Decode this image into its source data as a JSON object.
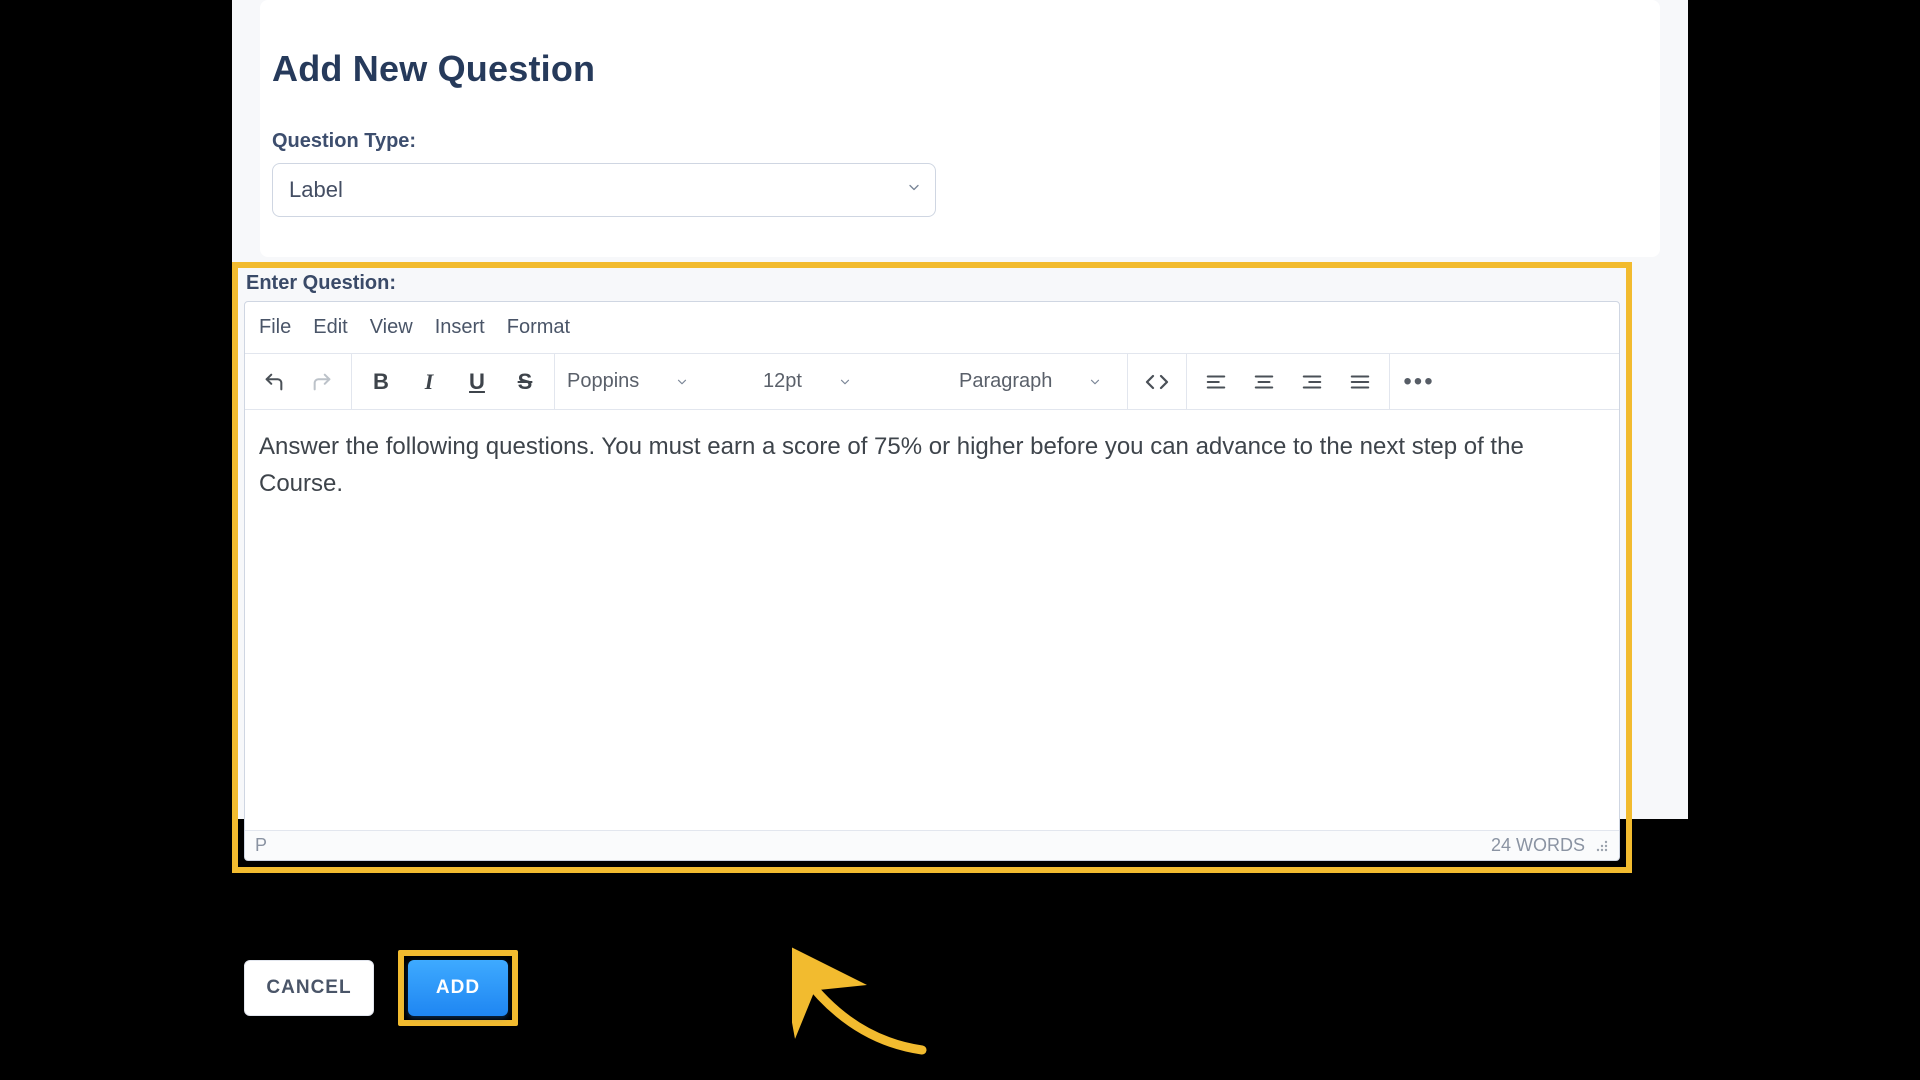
{
  "page": {
    "title": "Add New Question"
  },
  "questionType": {
    "label": "Question Type:",
    "value": "Label"
  },
  "enterQuestion": {
    "label": "Enter Question:"
  },
  "editor": {
    "menu": {
      "file": "File",
      "edit": "Edit",
      "view": "View",
      "insert": "Insert",
      "format": "Format"
    },
    "toolbar": {
      "font": "Poppins",
      "size": "12pt",
      "block": "Paragraph"
    },
    "content": "Answer the following questions. You must earn a score of 75% or higher before you can advance to the next step of the Course.",
    "status": {
      "path": "P",
      "wordcount": "24 WORDS"
    }
  },
  "buttons": {
    "cancel": "CANCEL",
    "add": "ADD"
  }
}
